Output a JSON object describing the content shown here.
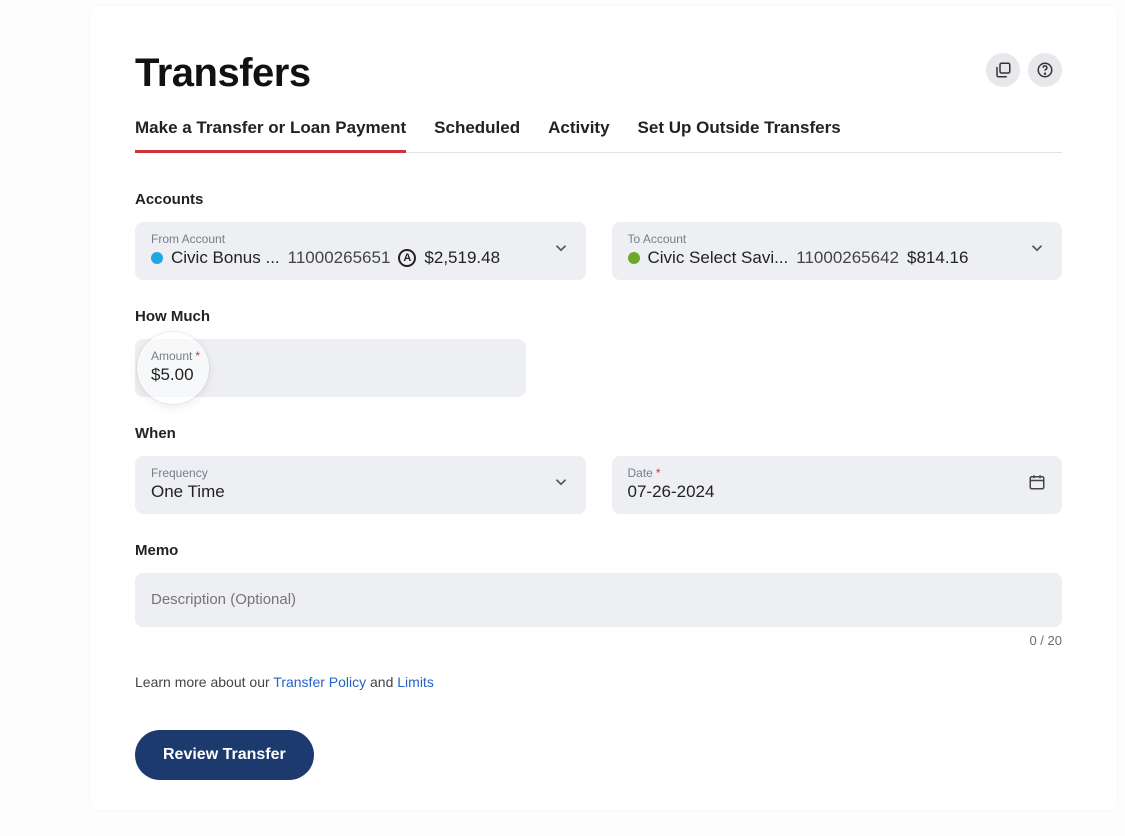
{
  "header": {
    "title": "Transfers"
  },
  "tabs": {
    "make": "Make a Transfer or Loan Payment",
    "scheduled": "Scheduled",
    "activity": "Activity",
    "outside": "Set Up Outside Transfers"
  },
  "sections": {
    "accounts": "Accounts",
    "how_much": "How Much",
    "when": "When",
    "memo": "Memo"
  },
  "from": {
    "label": "From Account",
    "name": "Civic Bonus ...",
    "number": "11000265651",
    "balance": "$2,519.48",
    "badge": "A"
  },
  "to": {
    "label": "To Account",
    "name": "Civic Select Savi...",
    "number": "11000265642",
    "balance": "$814.16"
  },
  "amount": {
    "label": "Amount",
    "value": "$5.00"
  },
  "frequency": {
    "label": "Frequency",
    "value": "One Time"
  },
  "date": {
    "label": "Date",
    "value": "07-26-2024"
  },
  "memo": {
    "placeholder": "Description (Optional)",
    "counter": "0 / 20"
  },
  "policy": {
    "pre": "Learn more about our ",
    "link1": "Transfer Policy",
    "mid": " and ",
    "link2": "Limits"
  },
  "cta": "Review Transfer"
}
